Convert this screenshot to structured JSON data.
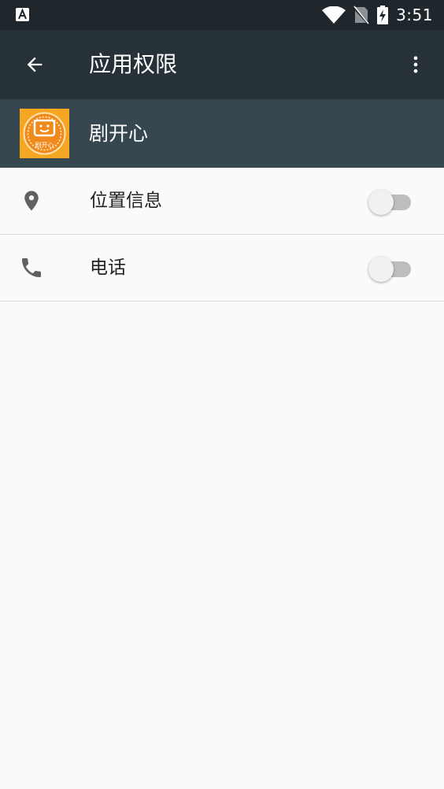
{
  "status_bar": {
    "left_icon": "font-a-icon",
    "icons": [
      "wifi-icon",
      "no-sim-icon",
      "battery-charging-icon"
    ],
    "time": "3:51"
  },
  "app_bar": {
    "back_icon": "arrow-back-icon",
    "title": "应用权限",
    "overflow_icon": "more-vert-icon"
  },
  "app": {
    "name": "剧开心",
    "icon_text": "剧开心"
  },
  "permissions": [
    {
      "icon": "location-pin-icon",
      "label": "位置信息",
      "enabled": false
    },
    {
      "icon": "phone-icon",
      "label": "电话",
      "enabled": false
    }
  ],
  "colors": {
    "status_bar": "#1f272c",
    "app_bar": "#263238",
    "app_header": "#37474f",
    "background": "#fafafa"
  }
}
